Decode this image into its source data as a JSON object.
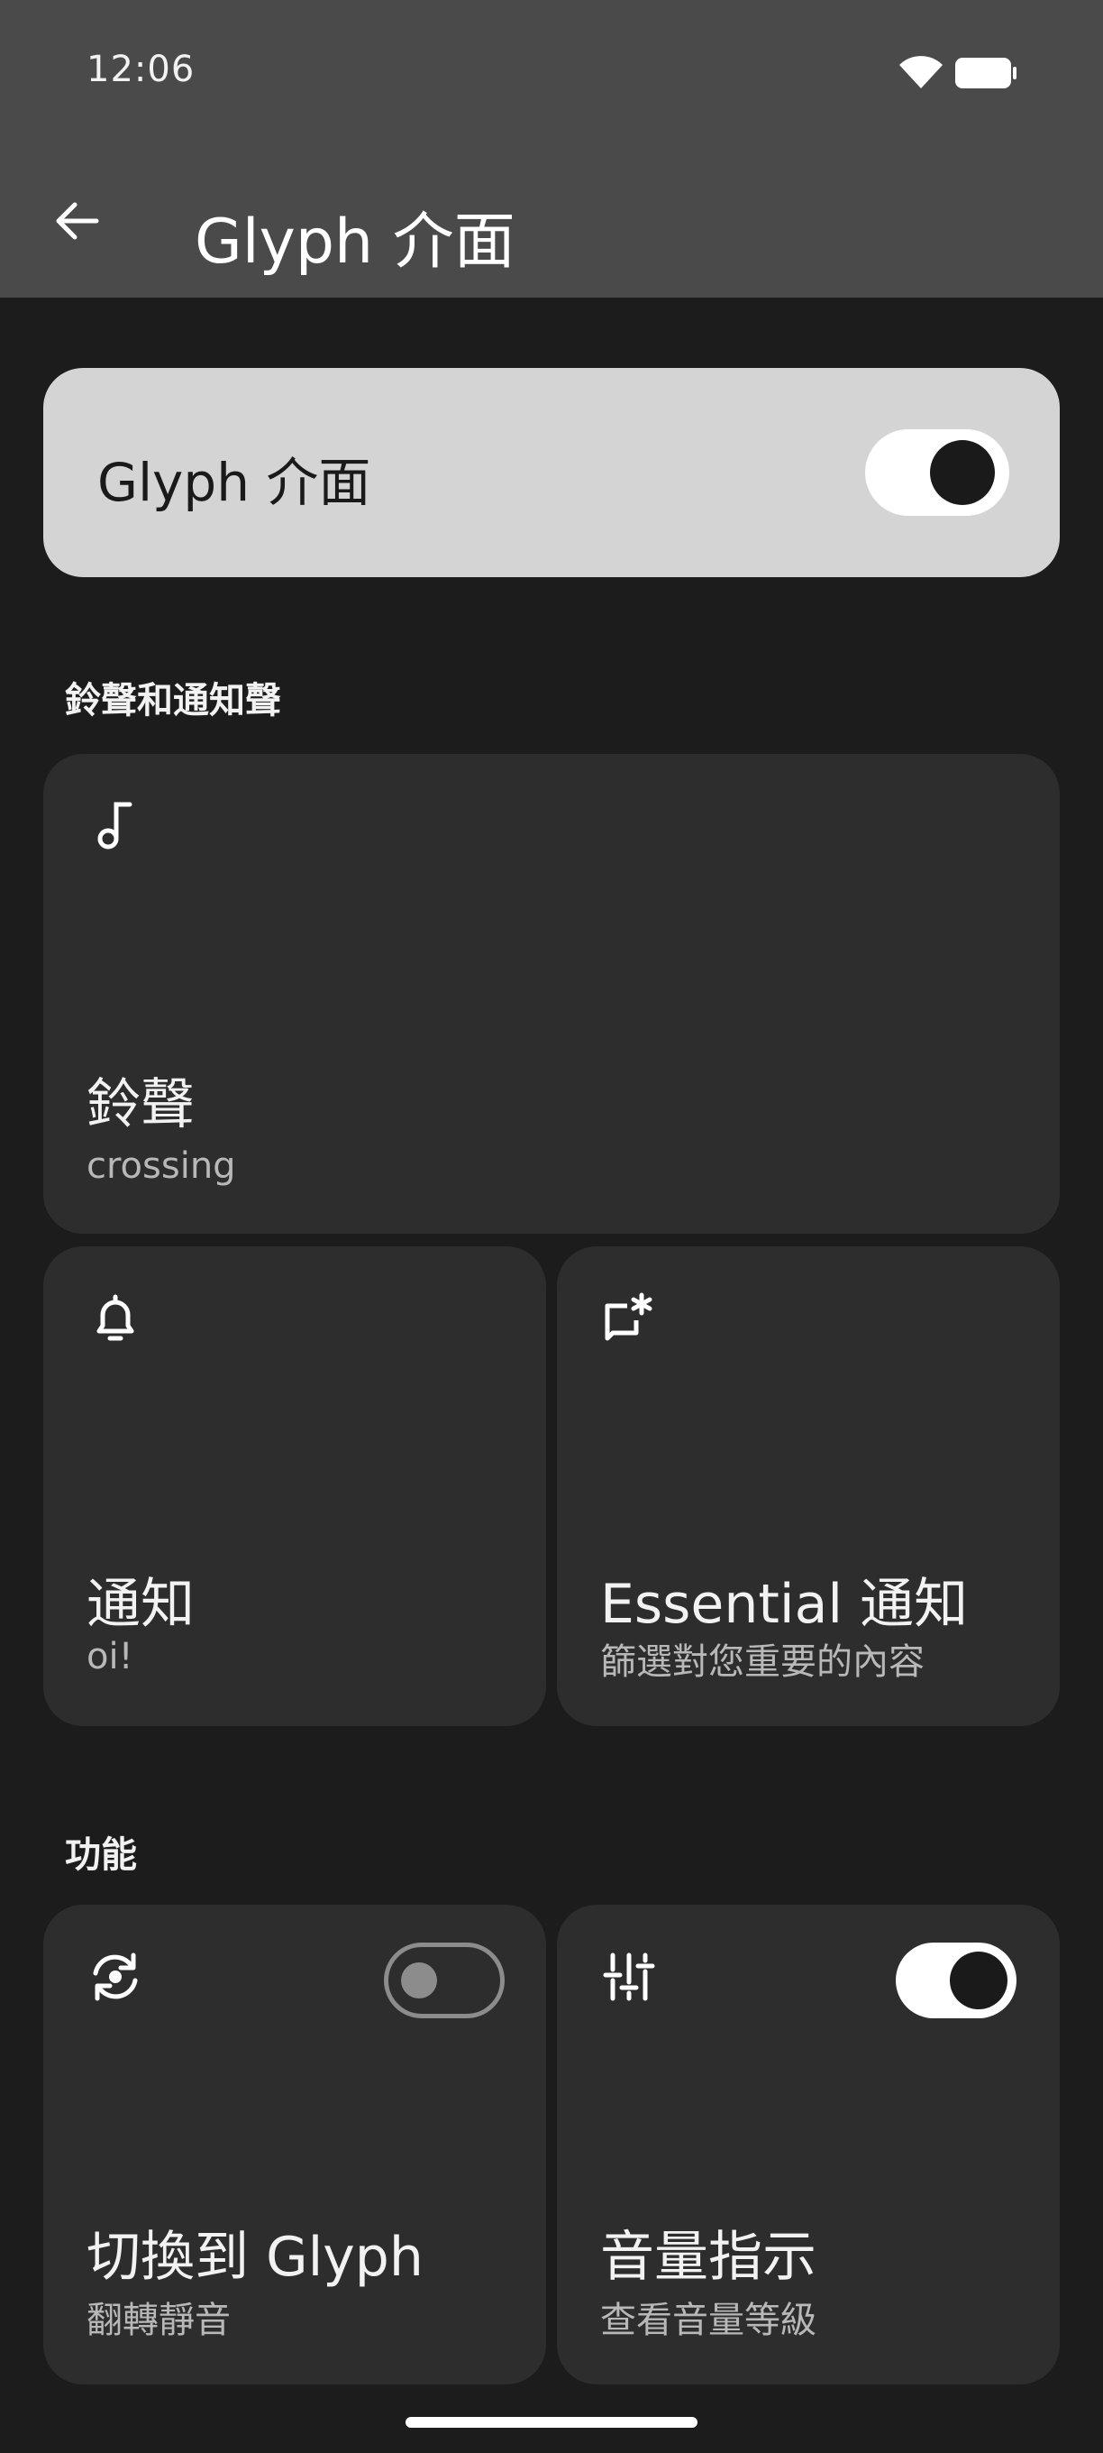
{
  "status_bar": {
    "time": "12:06",
    "wifi_icon": "wifi-icon",
    "battery_icon": "battery-icon"
  },
  "app_bar": {
    "back_icon": "arrow-back-icon",
    "title": "Glyph 介面"
  },
  "master_toggle": {
    "label": "Glyph 介面",
    "on": true
  },
  "sections": {
    "sounds": {
      "header": "鈴聲和通知聲"
    },
    "features": {
      "header": "功能"
    }
  },
  "cards": {
    "ringtone": {
      "icon": "music-note-icon",
      "title": "鈴聲",
      "subtitle": "crossing"
    },
    "notification": {
      "icon": "bell-icon",
      "title": "通知",
      "subtitle": "oi!"
    },
    "essential": {
      "icon": "essential-notification-icon",
      "title": "Essential 通知",
      "subtitle": "篩選對您重要的內容"
    },
    "flip_to_glyph": {
      "icon": "flip-camera-icon",
      "title": "切換到 Glyph",
      "subtitle": "翻轉靜音",
      "toggle_on": false
    },
    "volume_indicator": {
      "icon": "sliders-icon",
      "title": "音量指示",
      "subtitle": "查看音量等級",
      "toggle_on": true
    }
  },
  "colors": {
    "background": "#1c1c1c",
    "app_bar": "#4a4a4a",
    "card": "#2d2d2d",
    "master_card": "#d4d4d4",
    "toggle_on_track": "#ffffff",
    "toggle_knob_on": "#1a1a1a"
  }
}
